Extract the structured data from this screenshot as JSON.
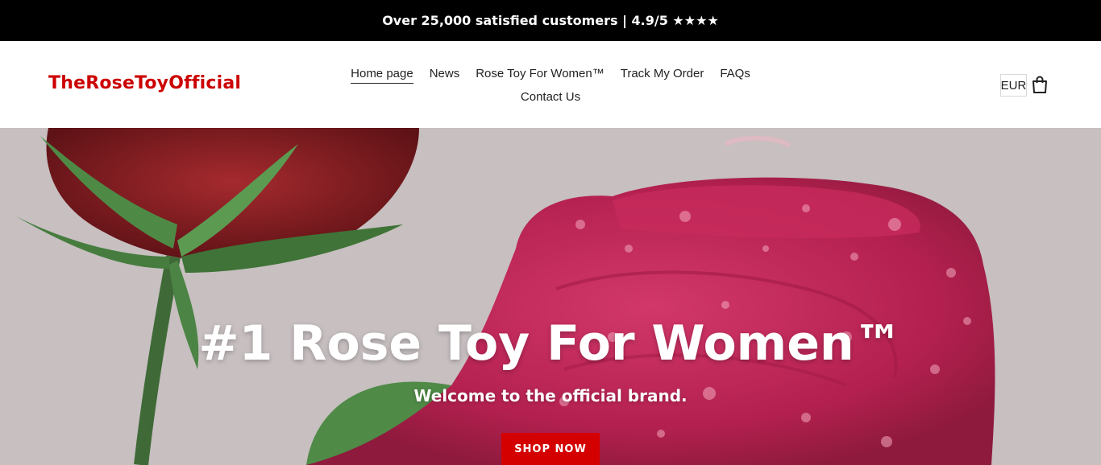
{
  "announcement": {
    "text": "Over 25,000 satisfied customers | 4.9/5 ★★★★"
  },
  "header": {
    "logo_part1": "TheRoseToy",
    "logo_part2": "Official",
    "nav": [
      {
        "label": "Home page",
        "active": true
      },
      {
        "label": "News"
      },
      {
        "label": "Rose Toy For Women™"
      },
      {
        "label": "Track My Order"
      },
      {
        "label": "FAQs"
      },
      {
        "label": "Contact Us"
      }
    ],
    "currency": "EUR",
    "cart_icon": "shopping-bag-icon"
  },
  "hero": {
    "title": "#1 Rose Toy For Women™",
    "subtitle": "Welcome to the official brand.",
    "cta": "SHOP NOW"
  },
  "colors": {
    "announcement_bg": "#000000",
    "logo": "#cc0000",
    "cta_bg": "#d40000",
    "hero_bg": "#c7bfc0"
  }
}
